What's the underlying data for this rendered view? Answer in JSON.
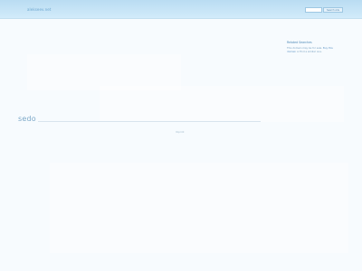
{
  "header": {
    "domain_title": "alekseev.net",
    "search_placeholder": "",
    "search_button_label": "Search Ads"
  },
  "related": {
    "title": "Related Searches",
    "text_before": "This domain may be for sale. ",
    "link_text": "Buy this domain",
    "text_after": " or find a similar one."
  },
  "brand": {
    "name": "sedo"
  },
  "footer": {
    "link_text": "Imprint"
  }
}
